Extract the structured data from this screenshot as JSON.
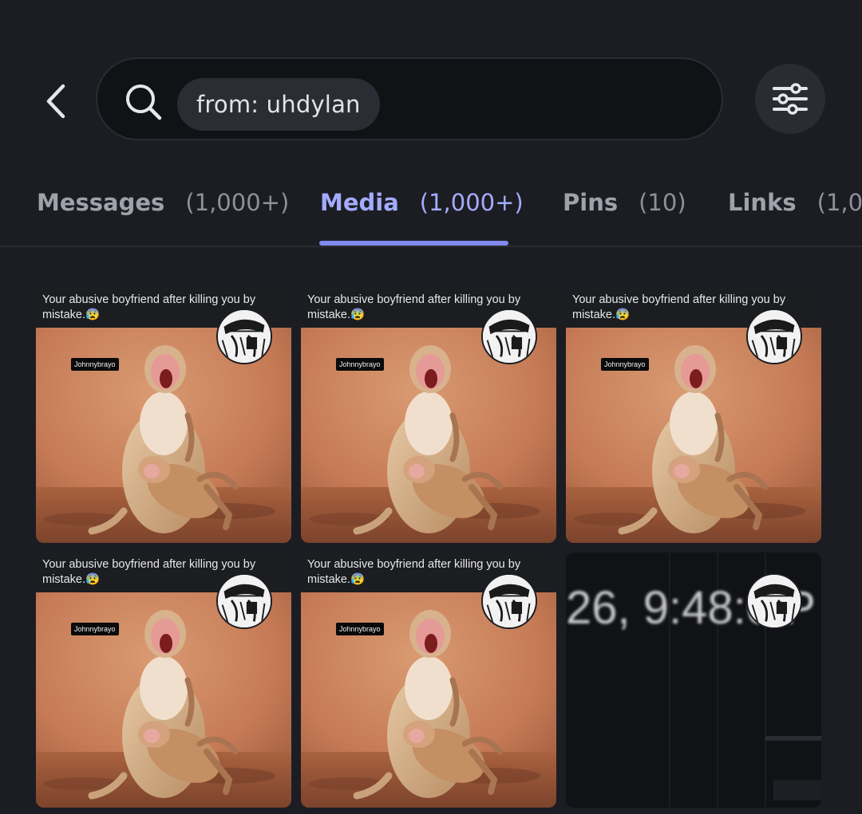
{
  "header": {
    "back_icon": "chevron-left-icon",
    "search_icon": "search-icon",
    "search_chip": "from: uhdylan",
    "filter_icon": "sliders-icon"
  },
  "tabs": [
    {
      "label": "Messages",
      "count": "(1,000+)",
      "active": false
    },
    {
      "label": "Media",
      "count": "(1,000+)",
      "active": true
    },
    {
      "label": "Pins",
      "count": "(10)",
      "active": false
    },
    {
      "label": "Links",
      "count": "(1,0",
      "active": false
    }
  ],
  "media": [
    {
      "caption": "Your abusive boyfriend after killing you by mistake.😰",
      "watermark": "Johnnybrayo"
    },
    {
      "caption": "Your abusive boyfriend after killing you by mistake.😰",
      "watermark": "Johnnybrayo"
    },
    {
      "caption": "Your abusive boyfriend after killing you by mistake.😰",
      "watermark": "Johnnybrayo"
    },
    {
      "caption": "Your abusive boyfriend after killing you by mistake.😰",
      "watermark": "Johnnybrayo"
    },
    {
      "caption": "Your abusive boyfriend after killing you by mistake.😰",
      "watermark": "Johnnybrayo"
    },
    {
      "timestamp_fragment": "26, 9:48:0 P"
    }
  ],
  "colors": {
    "background": "#1c1d23",
    "search_bg": "#111216",
    "chip_bg": "#2c2d34",
    "active_tab": "#a3acff",
    "indicator": "#7f89ee",
    "inactive_tab": "#9fa1ab"
  }
}
